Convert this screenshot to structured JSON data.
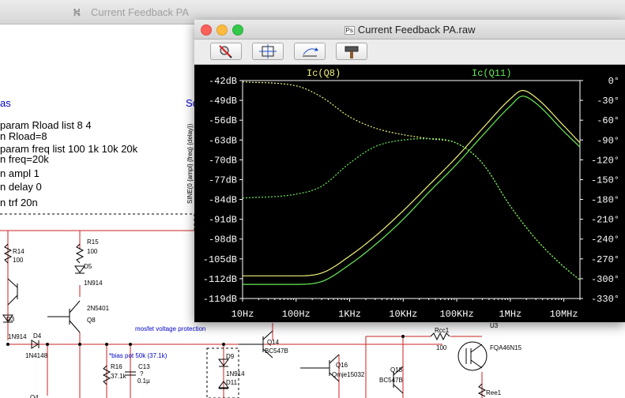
{
  "background_window": {
    "title": "Current Feedback PA",
    "directives": {
      "section1": "as",
      "section2": "Sc",
      "lines": [
        "param Rload list 8 4",
        "n Rload=8",
        "param freq list 100 1k 10k 20k",
        "n freq=20k",
        "n ampl 1",
        "n delay 0",
        "n trf 20n"
      ]
    },
    "components": {
      "r14_name": "R14",
      "r14_val": "100",
      "r15_name": "R15",
      "r15_val": "100",
      "d5_name": "D5",
      "d5_val": "1N914",
      "q8_model": "2N5401",
      "q8_name": "Q8",
      "d3_name": "D3",
      "d3_val": "1N914",
      "d4_name": "D4",
      "d4_val": "1N4148",
      "mosfet_note": "mosfet voltage protection",
      "bias_note": "*bias pot 50k (37.1k)",
      "r16_name": "R16",
      "r16_val": "37.1k",
      "c13_name": "C13",
      "c13_q": "?",
      "c13_val": "0.1µ",
      "d9_name": "D9",
      "d9_val": "1N914",
      "d11_name": "D11",
      "q14_name": "Q14",
      "q14_model": "BC547B",
      "q16_name": "Q16",
      "q16_model": "Qmje15032",
      "q18_name": "Q18",
      "q18_model": "BC547B",
      "rcc1_name": "Rcc1",
      "rcc1_val": "100",
      "u3_name": "U3",
      "u3_model": "FQA46N15",
      "ree1_name": "Ree1",
      "q4_name": "Q4"
    },
    "sine_label": "SINE(0 {ampl} {freq} {delay})"
  },
  "plot_window": {
    "title": "Current Feedback PA.raw",
    "file_icon": "Ps",
    "toolbar_icons": [
      "zoom-cancel-icon",
      "autorange-icon",
      "pan-icon",
      "probe-hammer-icon"
    ],
    "colors": {
      "q8": "#f2f27a",
      "q11": "#66ee55",
      "axis": "#ffffff",
      "background": "#000000"
    }
  },
  "chart_data": {
    "type": "line",
    "title": "",
    "xscale": "log",
    "xlim": [
      10,
      20000000
    ],
    "x_ticks": [
      {
        "value": 10,
        "label": "10Hz"
      },
      {
        "value": 100,
        "label": "100Hz"
      },
      {
        "value": 1000,
        "label": "1KHz"
      },
      {
        "value": 10000,
        "label": "10KHz"
      },
      {
        "value": 100000,
        "label": "100KHz"
      },
      {
        "value": 1000000,
        "label": "1MHz"
      },
      {
        "value": 10000000,
        "label": "10MHz"
      }
    ],
    "ylim_left": [
      -119,
      -42
    ],
    "y_left_ticks": [
      {
        "value": -42,
        "label": "-42dB"
      },
      {
        "value": -49,
        "label": "-49dB"
      },
      {
        "value": -56,
        "label": "-56dB"
      },
      {
        "value": -63,
        "label": "-63dB"
      },
      {
        "value": -70,
        "label": "-70dB"
      },
      {
        "value": -77,
        "label": "-77dB"
      },
      {
        "value": -84,
        "label": "-84dB"
      },
      {
        "value": -91,
        "label": "-91dB"
      },
      {
        "value": -98,
        "label": "-98dB"
      },
      {
        "value": -105,
        "label": "-105dB"
      },
      {
        "value": -112,
        "label": "-112dB"
      },
      {
        "value": -119,
        "label": "-119dB"
      }
    ],
    "ylim_right": [
      -330,
      0
    ],
    "y_right_ticks": [
      {
        "value": 0,
        "label": "0°"
      },
      {
        "value": -30,
        "label": "-30°"
      },
      {
        "value": -60,
        "label": "-60°"
      },
      {
        "value": -90,
        "label": "-90°"
      },
      {
        "value": -120,
        "label": "-120°"
      },
      {
        "value": -150,
        "label": "-150°"
      },
      {
        "value": -180,
        "label": "-180°"
      },
      {
        "value": -210,
        "label": "-210°"
      },
      {
        "value": -240,
        "label": "-240°"
      },
      {
        "value": -270,
        "label": "-270°"
      },
      {
        "value": -300,
        "label": "-300°"
      },
      {
        "value": -330,
        "label": "-330°"
      }
    ],
    "series": [
      {
        "name": "Ic(Q8)",
        "quantity": "magnitude",
        "axis": "left",
        "style": "solid",
        "color": "#f2f27a",
        "points": [
          [
            10,
            -111
          ],
          [
            100,
            -111
          ],
          [
            300,
            -110
          ],
          [
            1000,
            -104
          ],
          [
            3000,
            -97
          ],
          [
            10000,
            -88
          ],
          [
            30000,
            -79
          ],
          [
            100000,
            -69
          ],
          [
            300000,
            -59
          ],
          [
            1000000,
            -48.5
          ],
          [
            1700000,
            -45.5
          ],
          [
            3000000,
            -48
          ],
          [
            10000000,
            -58
          ],
          [
            20000000,
            -64
          ]
        ]
      },
      {
        "name": "Ic(Q11)",
        "quantity": "magnitude",
        "axis": "left",
        "style": "solid",
        "color": "#66ee55",
        "points": [
          [
            10,
            -114
          ],
          [
            100,
            -114
          ],
          [
            300,
            -113
          ],
          [
            1000,
            -107
          ],
          [
            3000,
            -100
          ],
          [
            10000,
            -91
          ],
          [
            30000,
            -81.5
          ],
          [
            100000,
            -71.5
          ],
          [
            300000,
            -61.5
          ],
          [
            1000000,
            -51
          ],
          [
            1700000,
            -47.5
          ],
          [
            3000000,
            -50
          ],
          [
            10000000,
            -60
          ],
          [
            20000000,
            -65.5
          ]
        ]
      },
      {
        "name": "Ic(Q8)",
        "quantity": "phase",
        "axis": "right",
        "style": "dashed",
        "color": "#f2f27a",
        "points": [
          [
            10,
            -2
          ],
          [
            100,
            -8
          ],
          [
            300,
            -25
          ],
          [
            1000,
            -55
          ],
          [
            3000,
            -72
          ],
          [
            10000,
            -82
          ],
          [
            30000,
            -88
          ],
          [
            100000,
            -95
          ],
          [
            300000,
            -125
          ],
          [
            1000000,
            -190
          ],
          [
            3000000,
            -240
          ],
          [
            10000000,
            -282
          ],
          [
            20000000,
            -302
          ]
        ]
      },
      {
        "name": "Ic(Q11)",
        "quantity": "phase",
        "axis": "right",
        "style": "dashed",
        "color": "#66ee55",
        "points": [
          [
            10,
            -178
          ],
          [
            100,
            -172
          ],
          [
            300,
            -160
          ],
          [
            1000,
            -125
          ],
          [
            3000,
            -100
          ],
          [
            10000,
            -90
          ],
          [
            30000,
            -88
          ],
          [
            100000,
            -95
          ],
          [
            300000,
            -125
          ],
          [
            1000000,
            -190
          ],
          [
            3000000,
            -240
          ],
          [
            10000000,
            -282
          ],
          [
            20000000,
            -302
          ]
        ]
      }
    ]
  }
}
